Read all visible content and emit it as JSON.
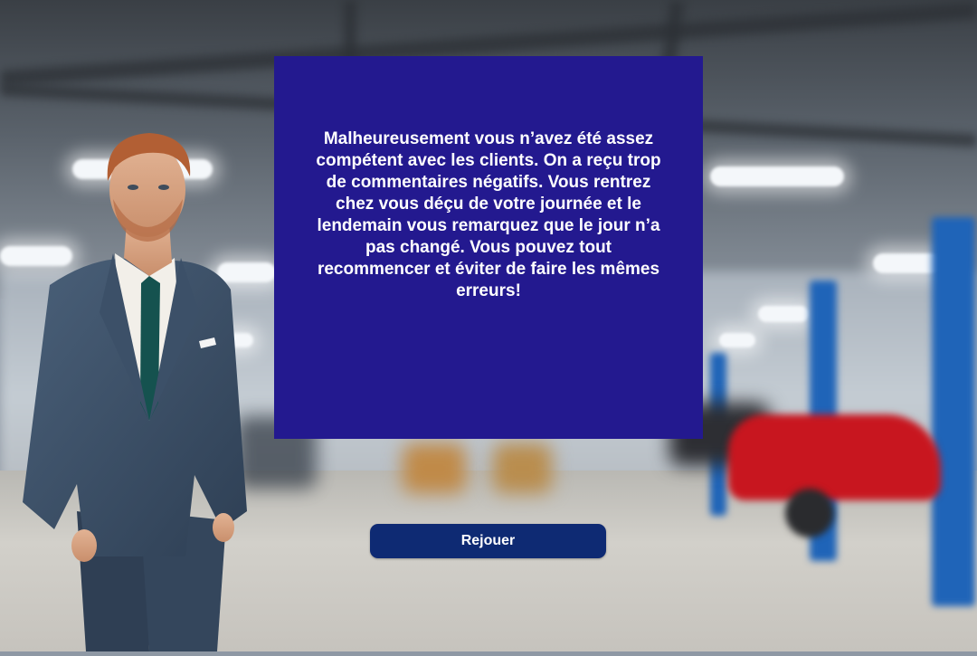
{
  "dialog": {
    "message": "Malheureusement vous n’avez été assez compétent avec les clients. On a reçu trop de commentaires négatifs. Vous rentrez chez vous déçu de votre journée et le lendemain vous remarquez que le jour n’a pas changé. Vous pouvez tout recommencer et éviter de faire les mêmes erreurs!"
  },
  "actions": {
    "replay_label": "Rejouer"
  },
  "colors": {
    "panel": "#23198f",
    "button": "#0e2a73",
    "text": "#ffffff"
  }
}
